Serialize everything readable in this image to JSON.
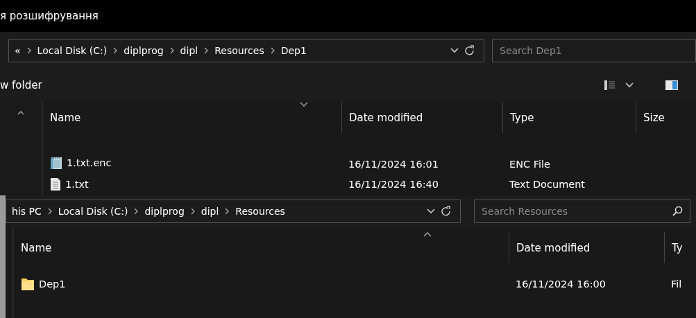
{
  "windows": [
    {
      "title": "я розшифрування",
      "breadcrumbs": [
        "«",
        "Local Disk (C:)",
        "diplprog",
        "dipl",
        "Resources",
        "Dep1"
      ],
      "search": {
        "placeholder": "Search Dep1"
      },
      "toolbar": {
        "new_folder": "w folder"
      },
      "columns": [
        "Name",
        "Date modified",
        "Type",
        "Size"
      ],
      "rows": [
        {
          "kind": "encrypted",
          "name": "1.txt.enc",
          "date": "16/11/2024 16:01",
          "type": "ENC File"
        },
        {
          "kind": "text",
          "name": "1.txt",
          "date": "16/11/2024 16:40",
          "type": "Text Document"
        }
      ]
    },
    {
      "breadcrumbs": [
        "his PC",
        "Local Disk (C:)",
        "diplprog",
        "dipl",
        "Resources"
      ],
      "search": {
        "placeholder": "Search Resources"
      },
      "columns": [
        "Name",
        "Date modified",
        "Ty"
      ],
      "rows": [
        {
          "kind": "folder",
          "name": "Dep1",
          "date": "16/11/2024 16:00",
          "type": "Fil"
        }
      ]
    }
  ]
}
